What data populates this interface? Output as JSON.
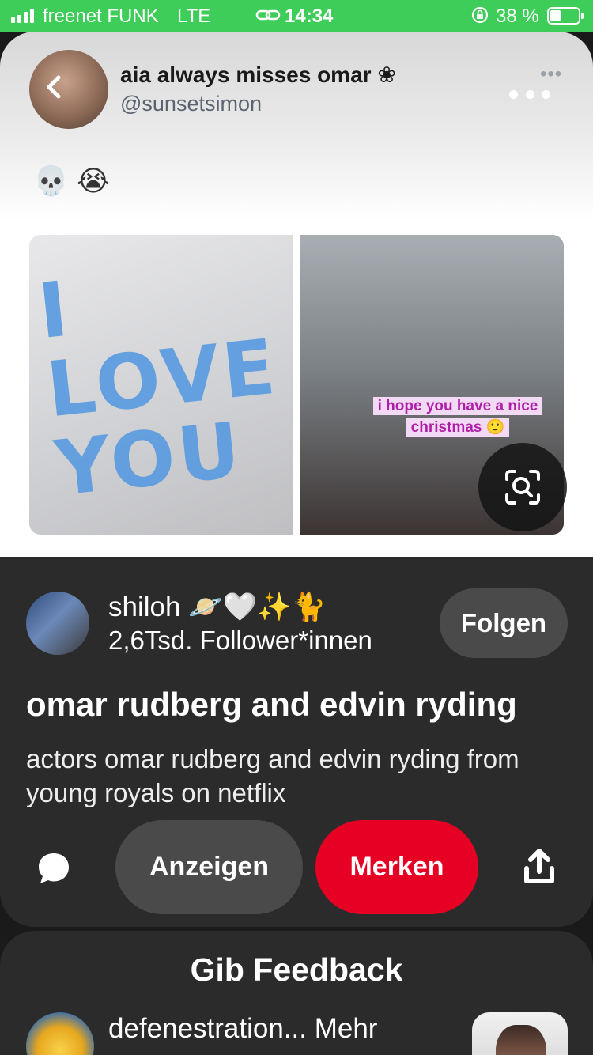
{
  "status_bar": {
    "carrier": "freenet FUNK",
    "network": "LTE",
    "time": "14:34",
    "battery_percent": "38 %",
    "battery_level": 0.38,
    "signal_bars": 4
  },
  "pin": {
    "tweet": {
      "display_name": "aia always misses omar ❀",
      "handle": "@sunsetsimon",
      "emoji": "💀 😭",
      "menu_dots": "•••",
      "photo_left_text": "I LOVE YOU",
      "photo_right_caption_line1": "i hope you have a nice",
      "photo_right_caption_line2": "christmas 🙂"
    },
    "creator": {
      "name": "shiloh 🪐🤍✨🐈",
      "followers": "2,6Tsd. Follower*innen",
      "follow_label": "Folgen"
    },
    "title": "omar rudberg and edvin ryding",
    "description": "actors omar rudberg and edvin ryding from young royals on netflix",
    "actions": {
      "view_label": "Anzeigen",
      "save_label": "Merken"
    }
  },
  "feedback": {
    "title": "Gib Feedback",
    "item_text": "defenestration... Mehr"
  },
  "colors": {
    "status_bar": "#3dcd58",
    "save_button": "#e60023",
    "card_background": "#2b2b2b",
    "pill_button": "#4a4a4a"
  },
  "icons": {
    "back": "chevron-left-icon",
    "more": "more-dots-icon",
    "lens": "visual-search-icon",
    "comment": "comment-bubble-icon",
    "share": "share-icon"
  }
}
